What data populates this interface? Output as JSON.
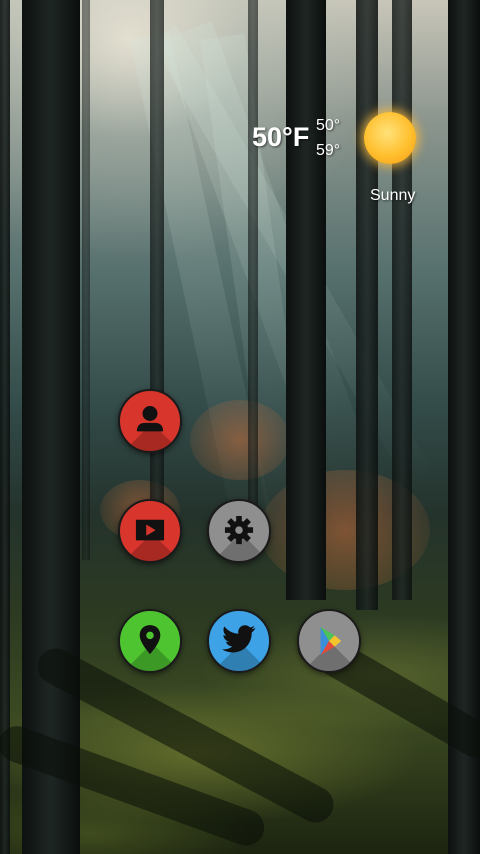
{
  "weather": {
    "temperature": "50°F",
    "high": "50°",
    "low": "59°",
    "condition": "Sunny",
    "icon": "sun-icon"
  },
  "apps": [
    {
      "name": "contacts",
      "icon": "person-icon",
      "color": "#d8352c"
    },
    {
      "name": "youtube",
      "icon": "play-screen-icon",
      "color": "#d8352c"
    },
    {
      "name": "settings",
      "icon": "gear-icon",
      "color": "#8f8f8f"
    },
    {
      "name": "maps",
      "icon": "map-pin-icon",
      "color": "#4fc431"
    },
    {
      "name": "twitter",
      "icon": "twitter-bird-icon",
      "color": "#3ea3e6"
    },
    {
      "name": "play-store",
      "icon": "play-store-icon",
      "color": "#8f8f8f"
    }
  ]
}
